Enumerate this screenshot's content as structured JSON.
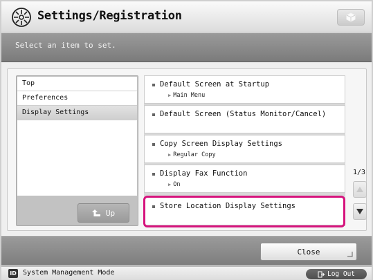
{
  "header": {
    "title": "Settings/Registration",
    "title_icon": "settings-registration-icon",
    "corner_icon": "cube-icon"
  },
  "message": "Select an item to set.",
  "nav": {
    "items": [
      {
        "label": "Top",
        "selected": false
      },
      {
        "label": "Preferences",
        "selected": false
      },
      {
        "label": "Display Settings",
        "selected": true
      }
    ],
    "up_label": "Up"
  },
  "items": [
    {
      "title": "Default Screen at Startup",
      "value": "Main Menu"
    },
    {
      "title": "Default Screen (Status Monitor/Cancel)",
      "value": ""
    },
    {
      "title": "Copy Screen Display Settings",
      "value": "Regular Copy"
    },
    {
      "title": "Display Fax Function",
      "value": "On"
    },
    {
      "title": "Store Location Display Settings",
      "value": ""
    }
  ],
  "highlighted_item": "Store Location Display Settings",
  "pager": {
    "indicator": "1/3"
  },
  "footer": {
    "close_label": "Close"
  },
  "status": {
    "mode_icon_text": "ID",
    "mode_text": "System Management Mode",
    "logout_label": "Log Out"
  },
  "colors": {
    "highlight": "#d6137d",
    "message_bar": "#8a8a8a"
  }
}
